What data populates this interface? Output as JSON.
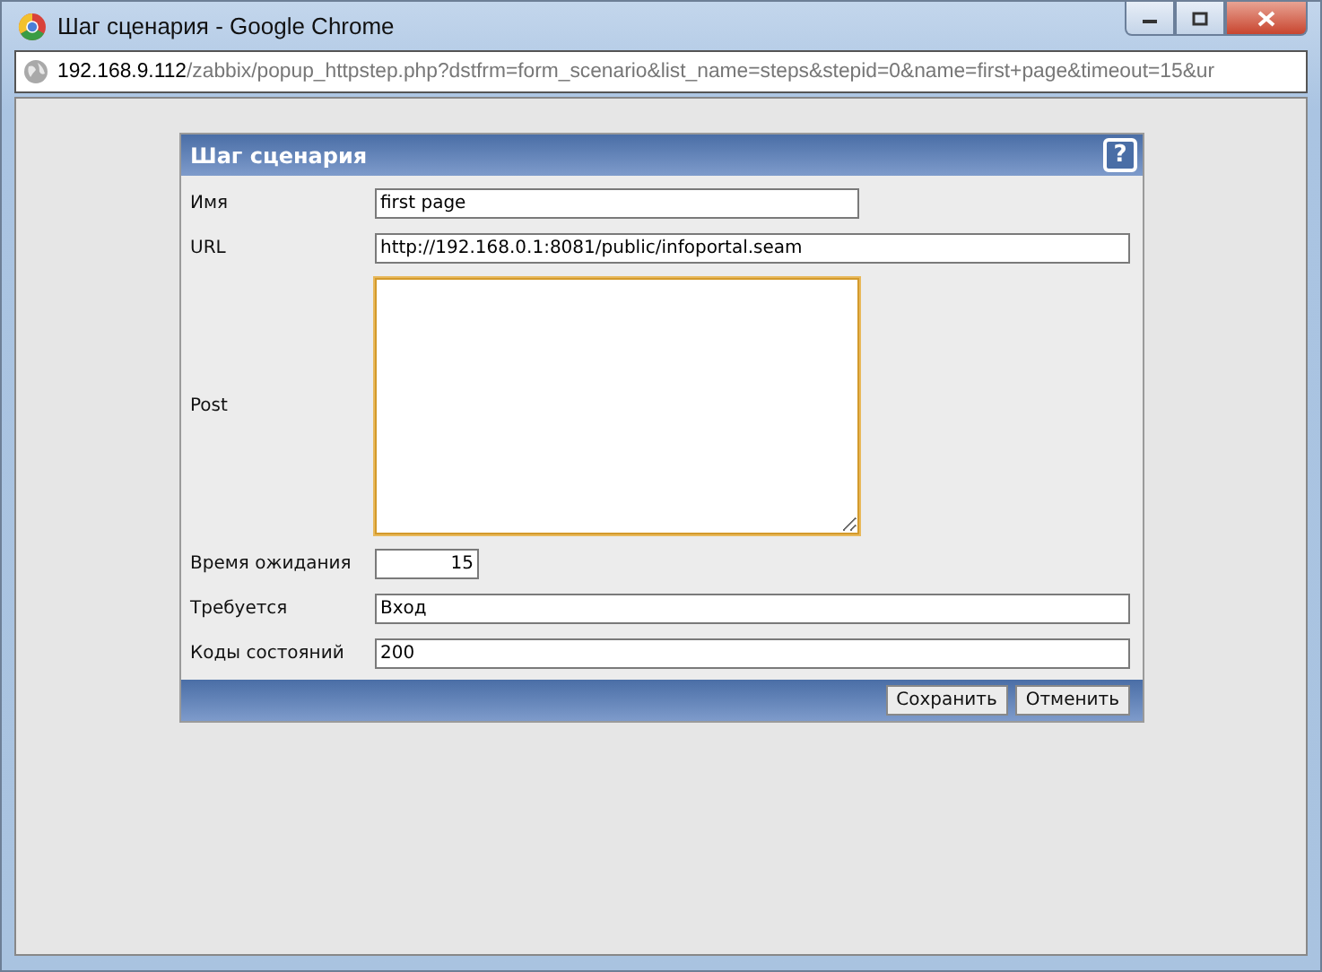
{
  "window": {
    "title": "Шаг сценария - Google Chrome"
  },
  "address_bar": {
    "host": "192.168.9.112",
    "path": "/zabbix/popup_httpstep.php?dstfrm=form_scenario&list_name=steps&stepid=0&name=first+page&timeout=15&ur"
  },
  "form": {
    "title": "Шаг сценария",
    "help_button": "?",
    "fields": [
      {
        "kind": "short",
        "label": "Имя",
        "value": "first page",
        "focused": false
      },
      {
        "kind": "long",
        "label": "URL",
        "value": "http://192.168.0.1:8081/public/infoportal.seam",
        "focused": false
      },
      {
        "kind": "textarea",
        "label": "Post",
        "focused": true
      },
      {
        "kind": "number",
        "label": "Время ожидания",
        "value": "15",
        "focused": false
      },
      {
        "kind": "long",
        "label": "Требуется",
        "value": "Вход",
        "focused": false
      },
      {
        "kind": "long",
        "label": "Коды состояний",
        "value": "200",
        "focused": false
      }
    ],
    "buttons": [
      "Сохранить",
      "Отменить"
    ]
  }
}
